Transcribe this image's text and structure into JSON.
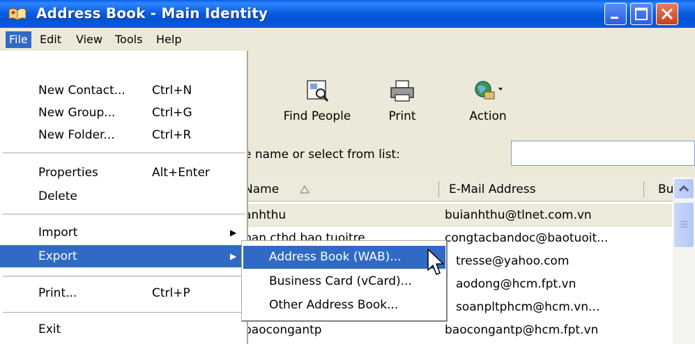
{
  "window": {
    "title": "Address Book - Main Identity",
    "icon": "address-book-icon",
    "controls": [
      "minimize-icon",
      "maximize-icon",
      "close-icon"
    ]
  },
  "menubar": {
    "items": [
      "File",
      "Edit",
      "View",
      "Tools",
      "Help"
    ],
    "active": "File"
  },
  "toolbar": {
    "buttons": [
      {
        "label": "Find People",
        "icon": "find-people-icon"
      },
      {
        "label": "Print",
        "icon": "printer-icon"
      },
      {
        "label": "Action",
        "icon": "action-globe-icon"
      }
    ]
  },
  "search": {
    "label": "e name or select from list:",
    "value": ""
  },
  "list": {
    "columns": [
      {
        "label": "Name",
        "sort": "ascending"
      },
      {
        "label": "E-Mail Address"
      },
      {
        "label": "Bu"
      }
    ],
    "rows": [
      {
        "name": "anhthu",
        "email": "buianhthu@tlnet.com.vn",
        "selected": true
      },
      {
        "name": "ban cthd bao tuoitre",
        "email": "congtacbandoc@baotuoit...",
        "selected": false
      },
      {
        "name": "",
        "email": "tresse@yahoo.com",
        "selected": false
      },
      {
        "name": "",
        "email": "aodong@hcm.fpt.vn",
        "selected": false
      },
      {
        "name": "",
        "email": "soanpltphcm@hcm.vn...",
        "selected": false
      },
      {
        "name": "baocongantp",
        "email": "baocongantp@hcm.fpt.vn",
        "selected": false
      }
    ]
  },
  "file_menu": {
    "items": [
      {
        "label": "New Contact...",
        "accel": "Ctrl+N"
      },
      {
        "label": "New Group...",
        "accel": "Ctrl+G"
      },
      {
        "label": "New Folder...",
        "accel": "Ctrl+R"
      },
      {
        "label": "Properties",
        "accel": "Alt+Enter"
      },
      {
        "label": "Delete",
        "accel": ""
      },
      {
        "label": "Import",
        "accel": "",
        "submenu": true
      },
      {
        "label": "Export",
        "accel": "",
        "submenu": true,
        "highlighted": true
      },
      {
        "label": "Print...",
        "accel": "Ctrl+P"
      },
      {
        "label": "Exit",
        "accel": ""
      }
    ]
  },
  "export_submenu": {
    "items": [
      {
        "label": "Address Book (WAB)...",
        "highlighted": true
      },
      {
        "label": "Business Card (vCard)..."
      },
      {
        "label": "Other Address Book..."
      }
    ]
  },
  "colors": {
    "title_bar": "#0452d4",
    "highlight": "#316ac5",
    "menu_background": "#ece9d8",
    "close_button": "#c63f1e"
  }
}
